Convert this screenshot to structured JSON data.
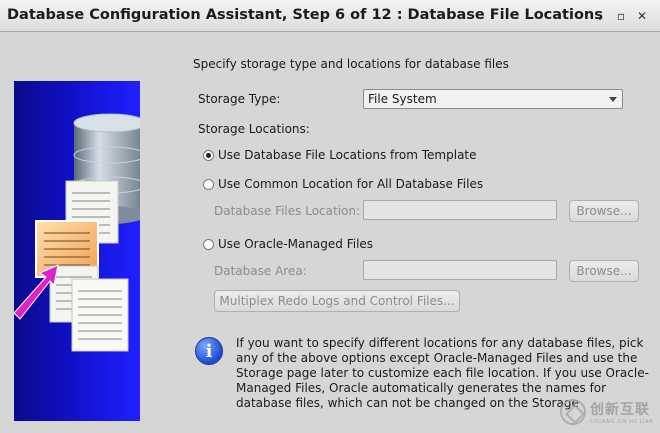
{
  "window": {
    "title": "Database Configuration Assistant, Step 6 of 12 : Database File Locations",
    "minimize_glyph": "⌄",
    "restore_glyph": "▫",
    "close_glyph": "✕"
  },
  "panel": {
    "description": "Specify storage type and locations for database files"
  },
  "storage_type": {
    "label": "Storage Type:",
    "selected": "File System"
  },
  "storage_locations": {
    "label": "Storage Locations:",
    "options": [
      {
        "label": "Use Database File Locations from Template",
        "checked": true
      },
      {
        "label": "Use Common Location for All Database Files",
        "checked": false
      },
      {
        "label": "Use Oracle-Managed Files",
        "checked": false
      }
    ],
    "files_location_label": "Database Files Location:",
    "files_location_value": "",
    "area_label": "Database Area:",
    "area_value": "",
    "browse_label": "Browse...",
    "multiplex_label": "Multiplex Redo Logs and Control Files..."
  },
  "info": {
    "icon": "info-icon",
    "lines": [
      "If you want to specify different locations for any database files, pick",
      "any of the above options except Oracle-Managed Files and use the",
      "Storage page later to customize each file location. If you use Oracle-",
      "Managed Files, Oracle automatically generates the names for",
      "database files, which can not be changed on the Storage"
    ]
  },
  "watermark": {
    "text": "创新互联",
    "sub": "CHUANG XIN HU LIAN"
  },
  "colors": {
    "graphic_blue": "#1010c8",
    "arrow_magenta": "#e020c8",
    "info_blue": "#1e4bd1"
  }
}
